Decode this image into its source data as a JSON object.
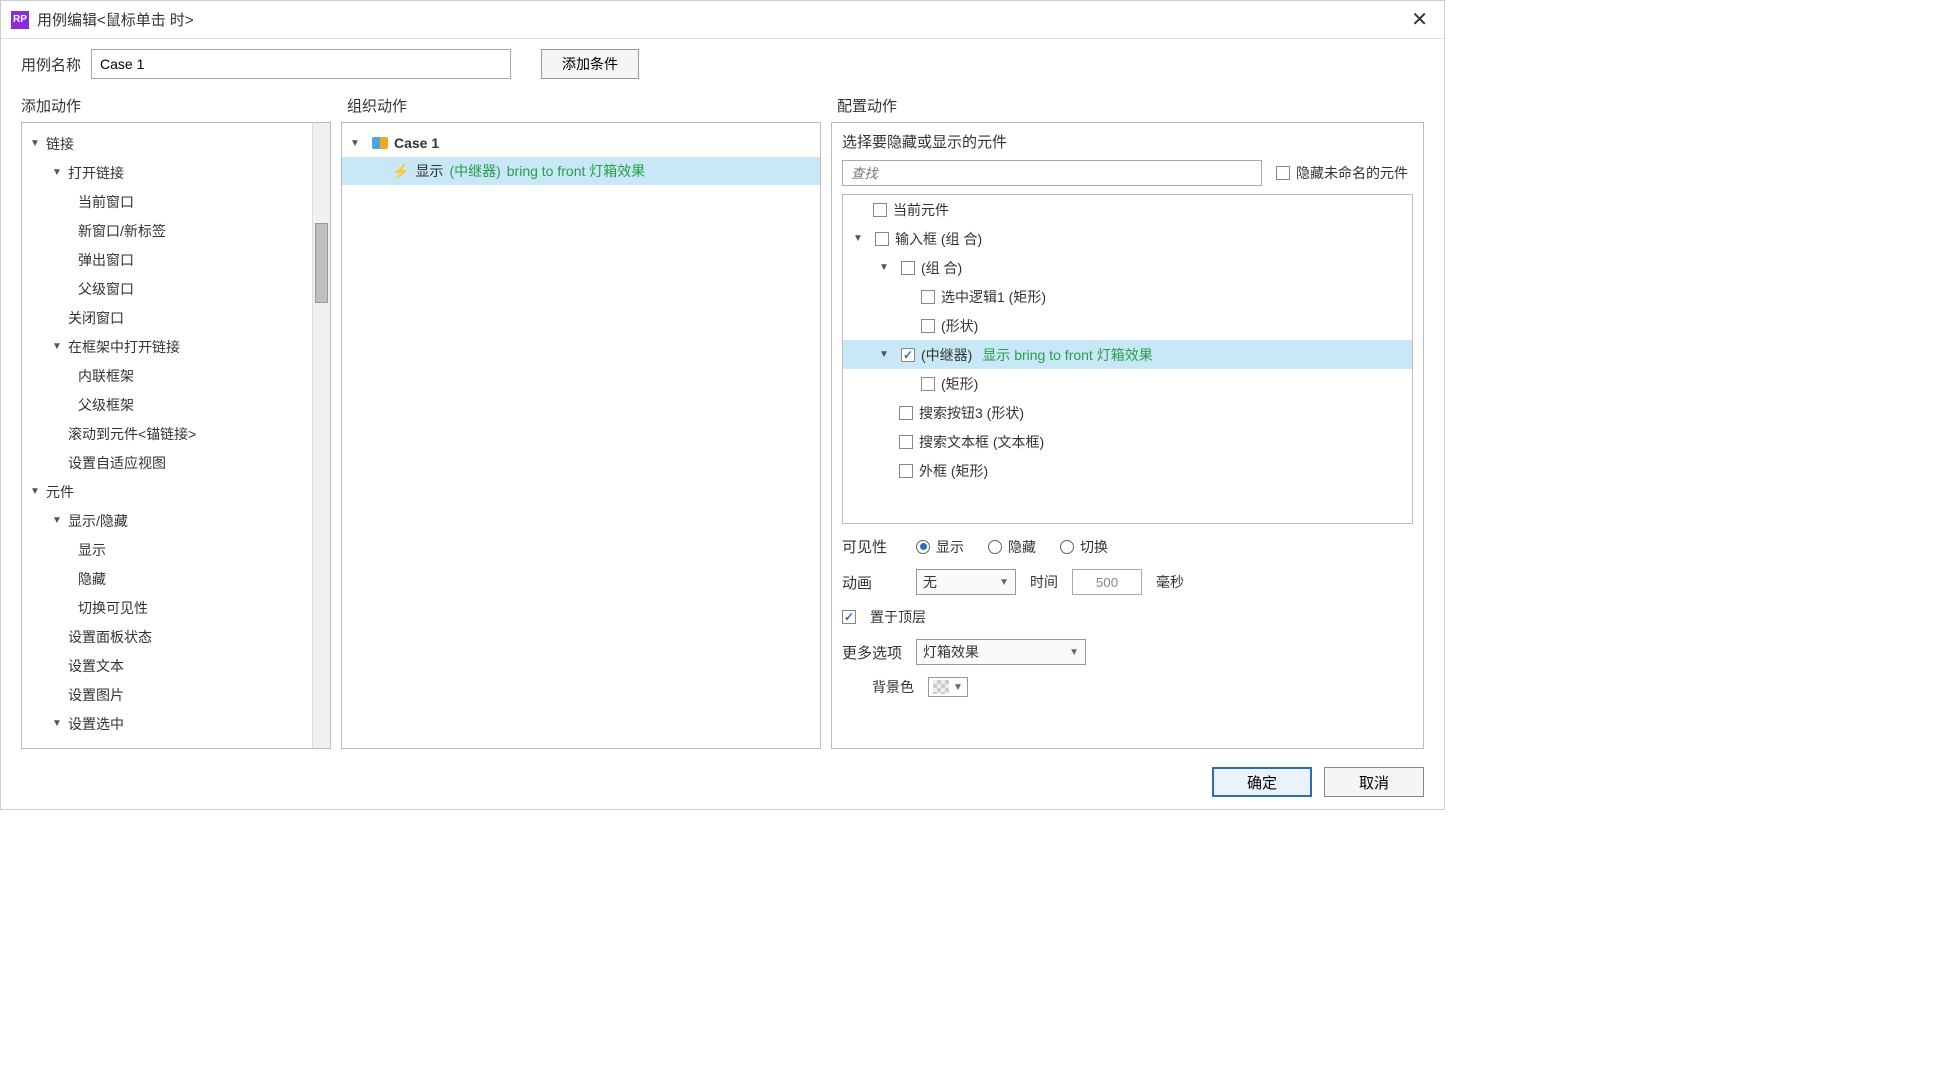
{
  "title": "用例编辑<鼠标单击 时>",
  "app_icon_text": "RP",
  "name_label": "用例名称",
  "case_name": "Case 1",
  "add_condition": "添加条件",
  "headers": {
    "add_action": "添加动作",
    "organize": "组织动作",
    "configure": "配置动作"
  },
  "actions_tree": {
    "links": {
      "label": "链接",
      "open_link": {
        "label": "打开链接",
        "current": "当前窗口",
        "new": "新窗口/新标签",
        "popup": "弹出窗口",
        "parent": "父级窗口"
      },
      "close_window": "关闭窗口",
      "open_in_frame": {
        "label": "在框架中打开链接",
        "inline": "内联框架",
        "parent": "父级框架"
      },
      "scroll_to": "滚动到元件<锚链接>",
      "set_adaptive": "设置自适应视图"
    },
    "widgets": {
      "label": "元件",
      "show_hide": {
        "label": "显示/隐藏",
        "show": "显示",
        "hide": "隐藏",
        "toggle": "切换可见性"
      },
      "set_panel": "设置面板状态",
      "set_text": "设置文本",
      "set_image": "设置图片",
      "set_selected": {
        "label": "设置选中"
      }
    }
  },
  "organize": {
    "case_label": "Case 1",
    "action_prefix": "显示",
    "action_target": "(中继器)",
    "action_suffix": "bring to front 灯箱效果"
  },
  "configure": {
    "select_header": "选择要隐藏或显示的元件",
    "search_placeholder": "查找",
    "hide_unnamed": "隐藏未命名的元件",
    "widget_tree": {
      "current": "当前元件",
      "input_group": "输入框 (组 合)",
      "group": "(组 合)",
      "logic1": "选中逻辑1 (矩形)",
      "shape": "(形状)",
      "repeater": "(中继器)",
      "repeater_extra": "显示 bring to front 灯箱效果",
      "rect": "(矩形)",
      "search_btn": "搜索按钮3 (形状)",
      "search_text": "搜索文本框 (文本框)",
      "outer": "外框 (矩形)"
    },
    "visibility": {
      "label": "可见性",
      "show": "显示",
      "hide": "隐藏",
      "toggle": "切换"
    },
    "animation": {
      "label": "动画",
      "value": "无",
      "time_label": "时间",
      "time_value": "500",
      "unit": "毫秒"
    },
    "bring_front": "置于顶层",
    "more": {
      "label": "更多选项",
      "value": "灯箱效果"
    },
    "bgcolor": "背景色"
  },
  "footer": {
    "ok": "确定",
    "cancel": "取消"
  }
}
